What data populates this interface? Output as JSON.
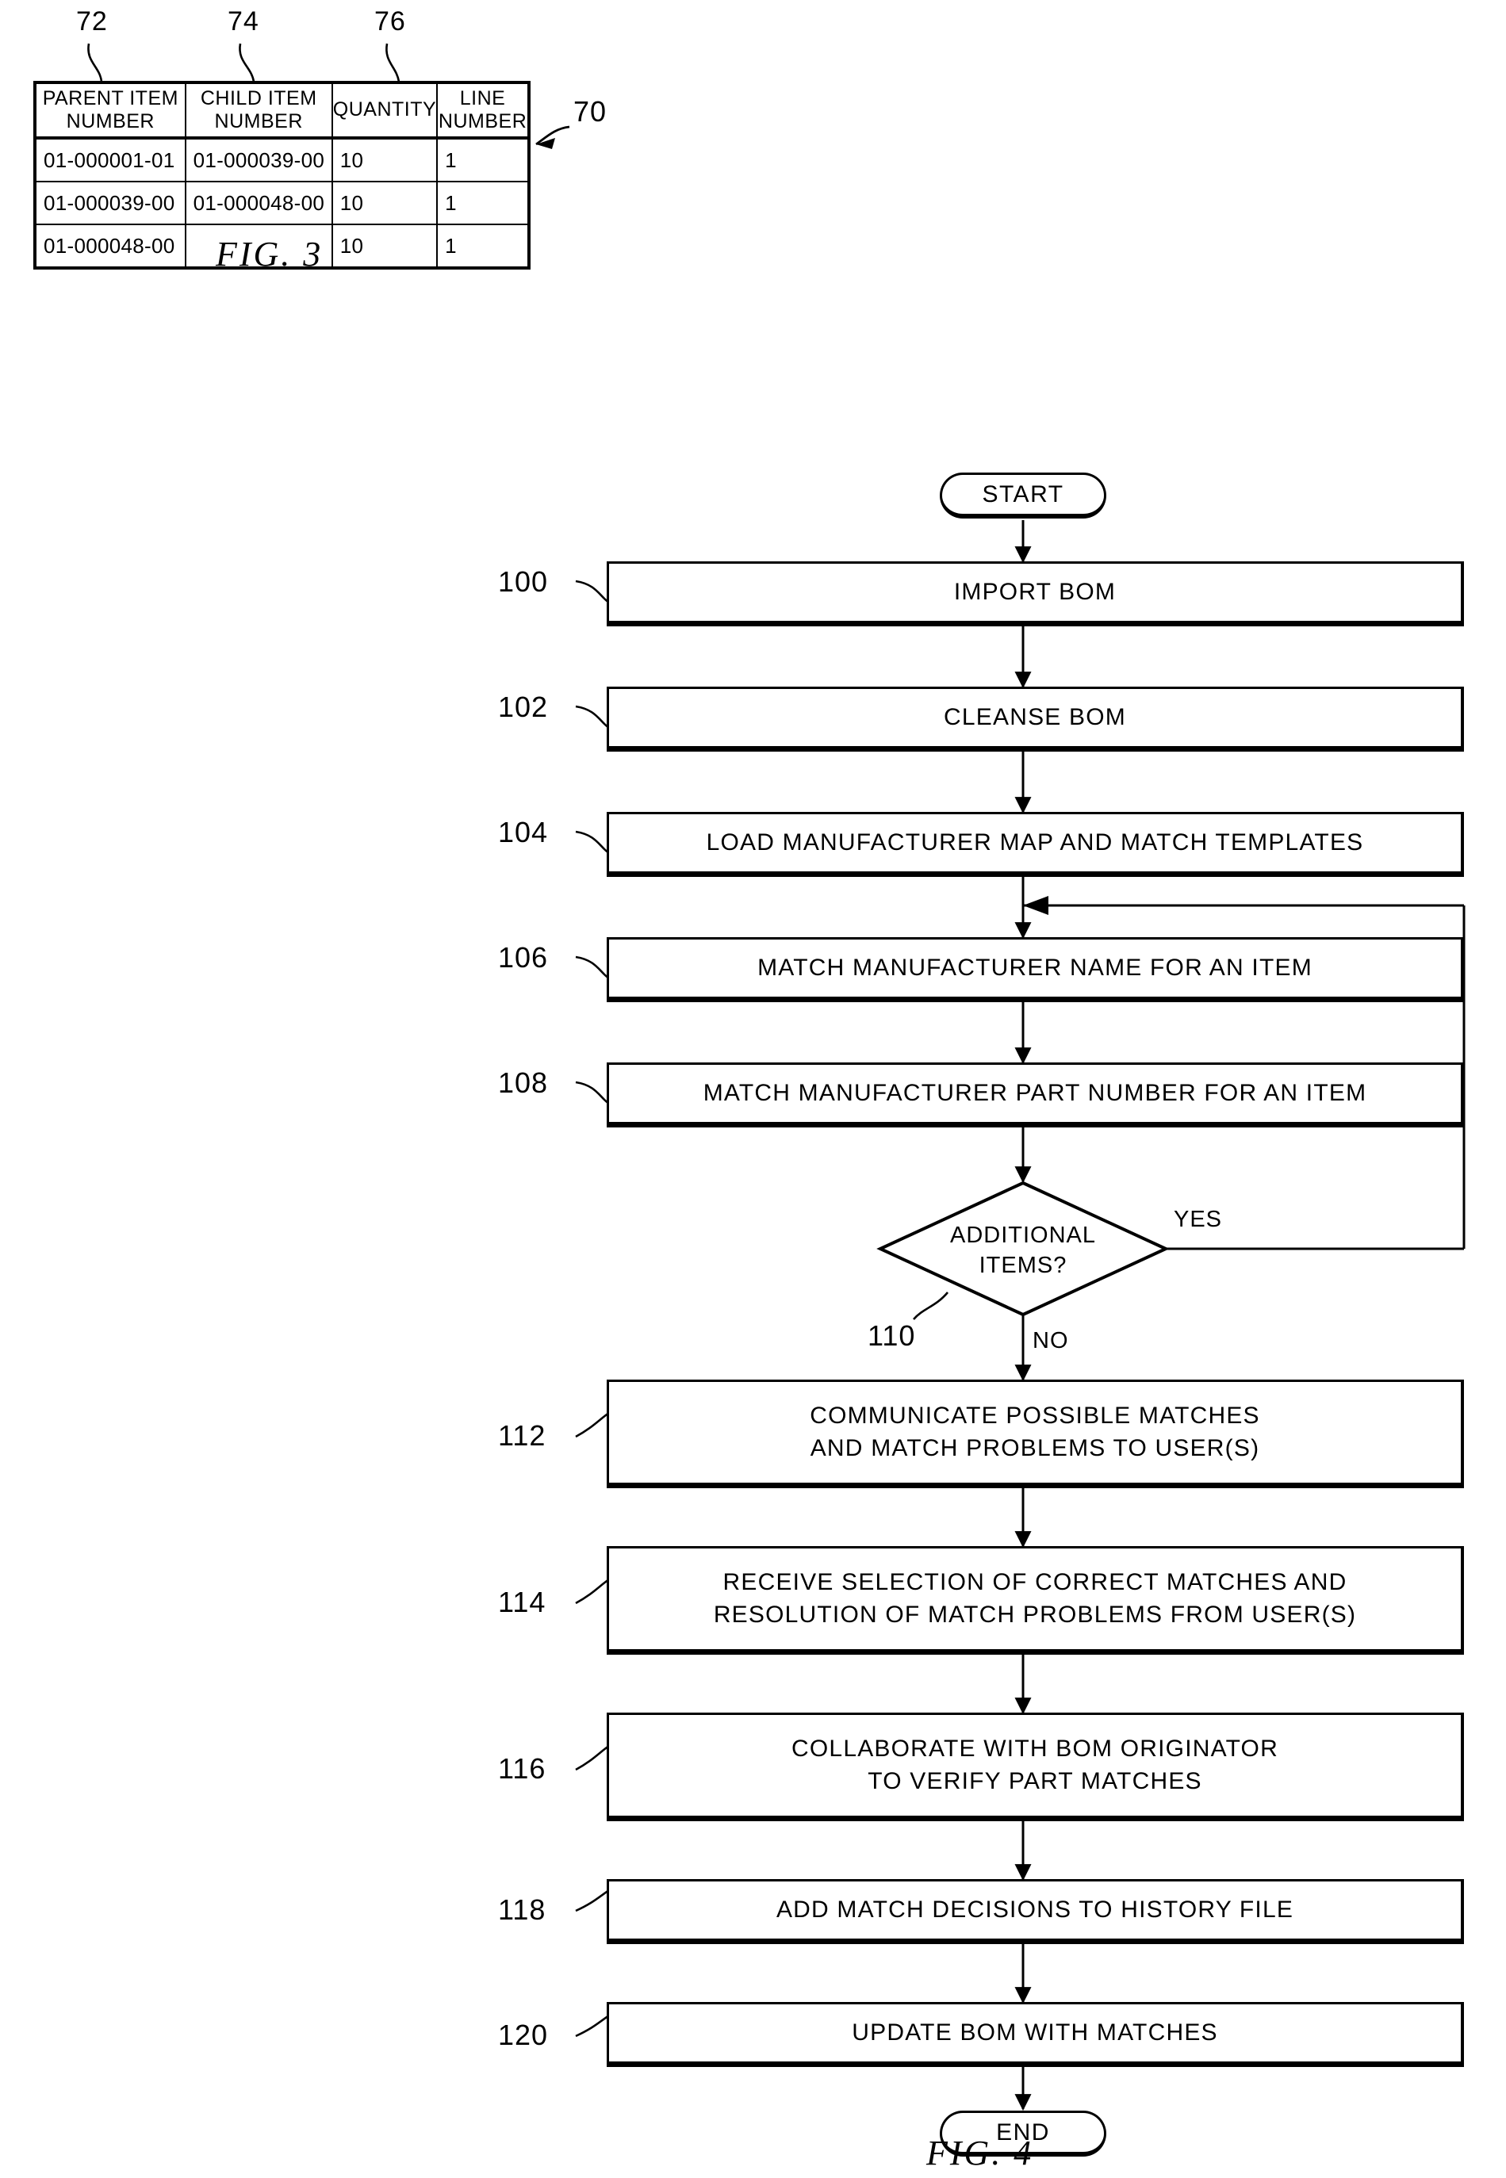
{
  "figure3": {
    "caption": "FIG.  3",
    "ref_label": "70",
    "column_refs": [
      "72",
      "74",
      "76"
    ],
    "table": {
      "headers": [
        {
          "line1": "PARENT ITEM",
          "line2": "NUMBER"
        },
        {
          "line1": "CHILD ITEM",
          "line2": "NUMBER"
        },
        {
          "line1": "QUANTITY",
          "line2": ""
        },
        {
          "line1": "LINE",
          "line2": "NUMBER"
        }
      ],
      "rows": [
        {
          "parent": "01-000001-01",
          "child": "01-000039-00",
          "quantity": "10",
          "line": "1"
        },
        {
          "parent": "01-000039-00",
          "child": "01-000048-00",
          "quantity": "10",
          "line": "1"
        },
        {
          "parent": "01-000048-00",
          "child": "",
          "quantity": "10",
          "line": "1"
        }
      ]
    }
  },
  "figure4": {
    "caption": "FIG.  4",
    "start_label": "START",
    "end_label": "END",
    "decision": {
      "ref": "110",
      "line1": "ADDITIONAL",
      "line2": "ITEMS?",
      "yes_label": "YES",
      "no_label": "NO"
    },
    "steps": [
      {
        "ref": "100",
        "line1": "IMPORT BOM",
        "line2": ""
      },
      {
        "ref": "102",
        "line1": "CLEANSE BOM",
        "line2": ""
      },
      {
        "ref": "104",
        "line1": "LOAD MANUFACTURER MAP AND MATCH TEMPLATES",
        "line2": ""
      },
      {
        "ref": "106",
        "line1": "MATCH MANUFACTURER NAME FOR AN ITEM",
        "line2": ""
      },
      {
        "ref": "108",
        "line1": "MATCH MANUFACTURER PART NUMBER FOR AN ITEM",
        "line2": ""
      },
      {
        "ref": "112",
        "line1": "COMMUNICATE POSSIBLE MATCHES",
        "line2": "AND MATCH PROBLEMS TO USER(S)"
      },
      {
        "ref": "114",
        "line1": "RECEIVE SELECTION OF CORRECT MATCHES AND",
        "line2": "RESOLUTION OF MATCH PROBLEMS FROM USER(S)"
      },
      {
        "ref": "116",
        "line1": "COLLABORATE WITH BOM ORIGINATOR",
        "line2": "TO VERIFY PART MATCHES"
      },
      {
        "ref": "118",
        "line1": "ADD MATCH DECISIONS TO HISTORY FILE",
        "line2": ""
      },
      {
        "ref": "120",
        "line1": "UPDATE BOM WITH MATCHES",
        "line2": ""
      }
    ]
  },
  "colors": {
    "ink": "#000000",
    "paper": "#ffffff"
  }
}
